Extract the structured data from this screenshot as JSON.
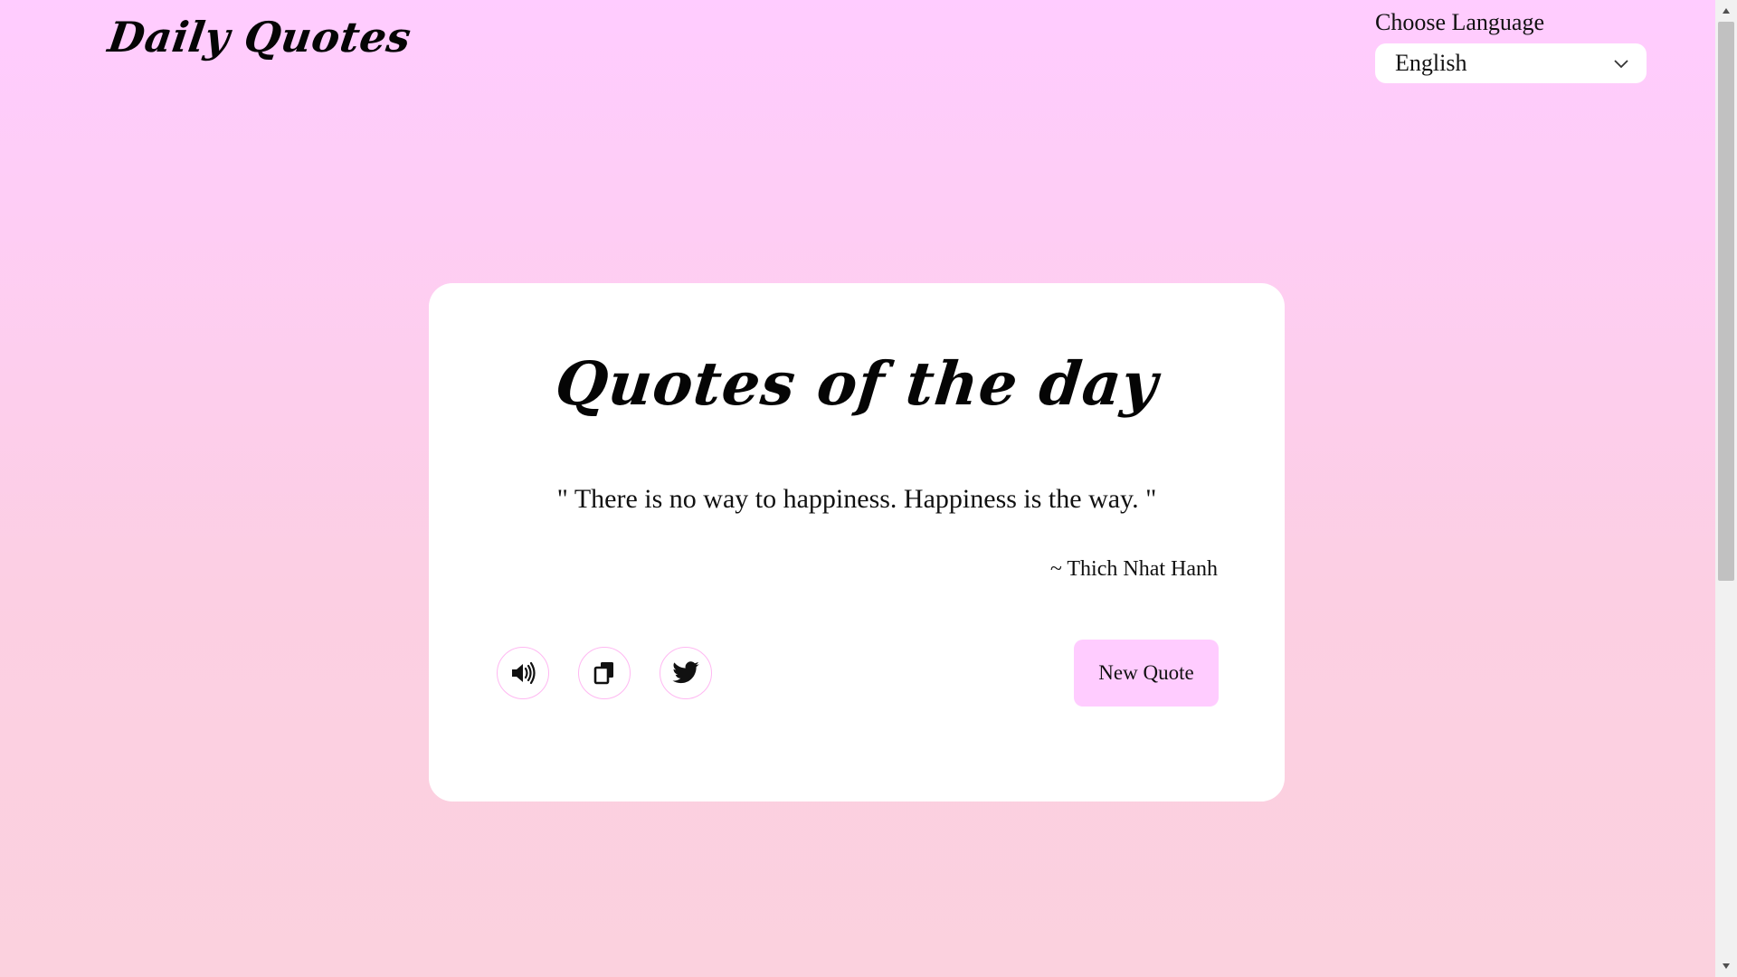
{
  "header": {
    "logo": "Daily Quotes"
  },
  "language": {
    "label": "Choose Language",
    "selected": "English"
  },
  "card": {
    "title": "Quotes of the day",
    "quote": "\" There is no way to happiness. Happiness is the way. \"",
    "author": "~ Thich Nhat Hanh",
    "new_quote_label": "New Quote",
    "actions": {
      "speak_icon": "speaker-icon",
      "copy_icon": "copy-icon",
      "share_icon": "twitter-icon"
    }
  },
  "colors": {
    "background_top": "#ffccff",
    "background_bottom": "#fbd1de",
    "button_bg": "#ffccff",
    "icon_border": "#ffb8f2",
    "card_bg": "#ffffff"
  }
}
